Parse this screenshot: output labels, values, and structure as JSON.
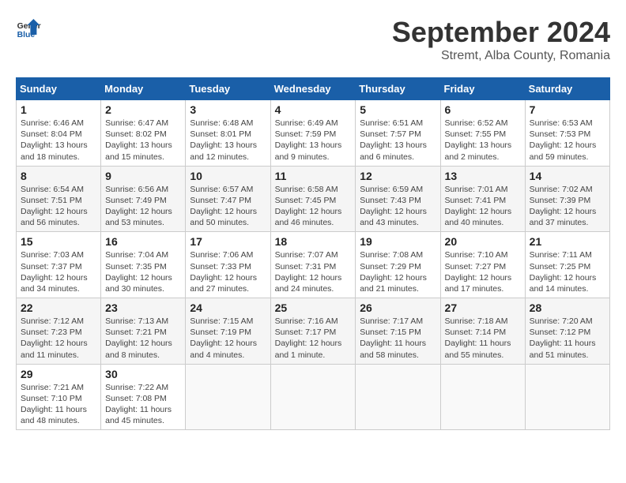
{
  "header": {
    "logo_line1": "General",
    "logo_line2": "Blue",
    "month_title": "September 2024",
    "location": "Stremt, Alba County, Romania"
  },
  "columns": [
    "Sunday",
    "Monday",
    "Tuesday",
    "Wednesday",
    "Thursday",
    "Friday",
    "Saturday"
  ],
  "weeks": [
    [
      {
        "day": "1",
        "sunrise": "Sunrise: 6:46 AM",
        "sunset": "Sunset: 8:04 PM",
        "daylight": "Daylight: 13 hours and 18 minutes."
      },
      {
        "day": "2",
        "sunrise": "Sunrise: 6:47 AM",
        "sunset": "Sunset: 8:02 PM",
        "daylight": "Daylight: 13 hours and 15 minutes."
      },
      {
        "day": "3",
        "sunrise": "Sunrise: 6:48 AM",
        "sunset": "Sunset: 8:01 PM",
        "daylight": "Daylight: 13 hours and 12 minutes."
      },
      {
        "day": "4",
        "sunrise": "Sunrise: 6:49 AM",
        "sunset": "Sunset: 7:59 PM",
        "daylight": "Daylight: 13 hours and 9 minutes."
      },
      {
        "day": "5",
        "sunrise": "Sunrise: 6:51 AM",
        "sunset": "Sunset: 7:57 PM",
        "daylight": "Daylight: 13 hours and 6 minutes."
      },
      {
        "day": "6",
        "sunrise": "Sunrise: 6:52 AM",
        "sunset": "Sunset: 7:55 PM",
        "daylight": "Daylight: 13 hours and 2 minutes."
      },
      {
        "day": "7",
        "sunrise": "Sunrise: 6:53 AM",
        "sunset": "Sunset: 7:53 PM",
        "daylight": "Daylight: 12 hours and 59 minutes."
      }
    ],
    [
      {
        "day": "8",
        "sunrise": "Sunrise: 6:54 AM",
        "sunset": "Sunset: 7:51 PM",
        "daylight": "Daylight: 12 hours and 56 minutes."
      },
      {
        "day": "9",
        "sunrise": "Sunrise: 6:56 AM",
        "sunset": "Sunset: 7:49 PM",
        "daylight": "Daylight: 12 hours and 53 minutes."
      },
      {
        "day": "10",
        "sunrise": "Sunrise: 6:57 AM",
        "sunset": "Sunset: 7:47 PM",
        "daylight": "Daylight: 12 hours and 50 minutes."
      },
      {
        "day": "11",
        "sunrise": "Sunrise: 6:58 AM",
        "sunset": "Sunset: 7:45 PM",
        "daylight": "Daylight: 12 hours and 46 minutes."
      },
      {
        "day": "12",
        "sunrise": "Sunrise: 6:59 AM",
        "sunset": "Sunset: 7:43 PM",
        "daylight": "Daylight: 12 hours and 43 minutes."
      },
      {
        "day": "13",
        "sunrise": "Sunrise: 7:01 AM",
        "sunset": "Sunset: 7:41 PM",
        "daylight": "Daylight: 12 hours and 40 minutes."
      },
      {
        "day": "14",
        "sunrise": "Sunrise: 7:02 AM",
        "sunset": "Sunset: 7:39 PM",
        "daylight": "Daylight: 12 hours and 37 minutes."
      }
    ],
    [
      {
        "day": "15",
        "sunrise": "Sunrise: 7:03 AM",
        "sunset": "Sunset: 7:37 PM",
        "daylight": "Daylight: 12 hours and 34 minutes."
      },
      {
        "day": "16",
        "sunrise": "Sunrise: 7:04 AM",
        "sunset": "Sunset: 7:35 PM",
        "daylight": "Daylight: 12 hours and 30 minutes."
      },
      {
        "day": "17",
        "sunrise": "Sunrise: 7:06 AM",
        "sunset": "Sunset: 7:33 PM",
        "daylight": "Daylight: 12 hours and 27 minutes."
      },
      {
        "day": "18",
        "sunrise": "Sunrise: 7:07 AM",
        "sunset": "Sunset: 7:31 PM",
        "daylight": "Daylight: 12 hours and 24 minutes."
      },
      {
        "day": "19",
        "sunrise": "Sunrise: 7:08 AM",
        "sunset": "Sunset: 7:29 PM",
        "daylight": "Daylight: 12 hours and 21 minutes."
      },
      {
        "day": "20",
        "sunrise": "Sunrise: 7:10 AM",
        "sunset": "Sunset: 7:27 PM",
        "daylight": "Daylight: 12 hours and 17 minutes."
      },
      {
        "day": "21",
        "sunrise": "Sunrise: 7:11 AM",
        "sunset": "Sunset: 7:25 PM",
        "daylight": "Daylight: 12 hours and 14 minutes."
      }
    ],
    [
      {
        "day": "22",
        "sunrise": "Sunrise: 7:12 AM",
        "sunset": "Sunset: 7:23 PM",
        "daylight": "Daylight: 12 hours and 11 minutes."
      },
      {
        "day": "23",
        "sunrise": "Sunrise: 7:13 AM",
        "sunset": "Sunset: 7:21 PM",
        "daylight": "Daylight: 12 hours and 8 minutes."
      },
      {
        "day": "24",
        "sunrise": "Sunrise: 7:15 AM",
        "sunset": "Sunset: 7:19 PM",
        "daylight": "Daylight: 12 hours and 4 minutes."
      },
      {
        "day": "25",
        "sunrise": "Sunrise: 7:16 AM",
        "sunset": "Sunset: 7:17 PM",
        "daylight": "Daylight: 12 hours and 1 minute."
      },
      {
        "day": "26",
        "sunrise": "Sunrise: 7:17 AM",
        "sunset": "Sunset: 7:15 PM",
        "daylight": "Daylight: 11 hours and 58 minutes."
      },
      {
        "day": "27",
        "sunrise": "Sunrise: 7:18 AM",
        "sunset": "Sunset: 7:14 PM",
        "daylight": "Daylight: 11 hours and 55 minutes."
      },
      {
        "day": "28",
        "sunrise": "Sunrise: 7:20 AM",
        "sunset": "Sunset: 7:12 PM",
        "daylight": "Daylight: 11 hours and 51 minutes."
      }
    ],
    [
      {
        "day": "29",
        "sunrise": "Sunrise: 7:21 AM",
        "sunset": "Sunset: 7:10 PM",
        "daylight": "Daylight: 11 hours and 48 minutes."
      },
      {
        "day": "30",
        "sunrise": "Sunrise: 7:22 AM",
        "sunset": "Sunset: 7:08 PM",
        "daylight": "Daylight: 11 hours and 45 minutes."
      },
      null,
      null,
      null,
      null,
      null
    ]
  ]
}
